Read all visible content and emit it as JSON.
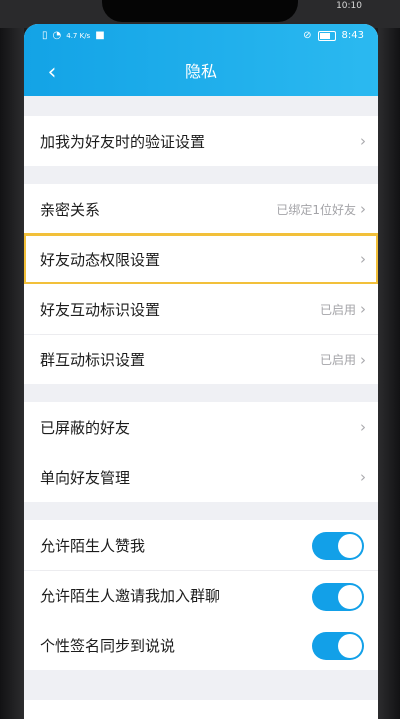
{
  "outer_status": {
    "left": "● ○ ◎",
    "time": "10:10"
  },
  "status_bar": {
    "time": "8:43",
    "speed": "4.7 K/s"
  },
  "header": {
    "title": "隐私",
    "back_icon": "chevron-left-icon"
  },
  "sections": {
    "verify": {
      "label": "加我为好友时的验证设置"
    },
    "intimate": {
      "label": "亲密关系",
      "value": "已绑定1位好友"
    },
    "feed_permission": {
      "label": "好友动态权限设置"
    },
    "friend_interaction": {
      "label": "好友互动标识设置",
      "value": "已启用"
    },
    "group_interaction": {
      "label": "群互动标识设置",
      "value": "已启用"
    },
    "blocked": {
      "label": "已屏蔽的好友"
    },
    "oneway": {
      "label": "单向好友管理"
    },
    "stranger_like": {
      "label": "允许陌生人赞我",
      "on": true
    },
    "stranger_invite": {
      "label": "允许陌生人邀请我加入群聊",
      "on": true
    },
    "signature_sync": {
      "label": "个性签名同步到说说",
      "on": true
    }
  },
  "chevron": "›",
  "colors": {
    "accent": "#12a0e8",
    "highlight": "#f2c03a",
    "header": "#1aa9ea"
  }
}
